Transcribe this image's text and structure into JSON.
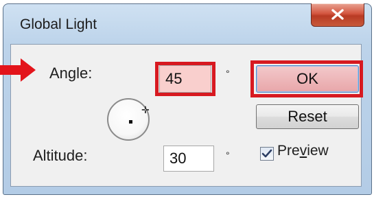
{
  "window": {
    "title": "Global Light",
    "close_icon": "close-x-icon"
  },
  "angle": {
    "label": "Angle:",
    "value": "45",
    "unit": "°",
    "highlight_color": "#d71920",
    "arrow_color": "#e3141b"
  },
  "altitude": {
    "label": "Altitude:",
    "value": "30",
    "unit": "°"
  },
  "dial_icon": "angle-dial-icon",
  "buttons": {
    "ok": "OK",
    "reset": "Reset"
  },
  "preview": {
    "label_pre": "Pre",
    "label_mnemonic": "v",
    "label_post": "iew",
    "checked": true
  }
}
